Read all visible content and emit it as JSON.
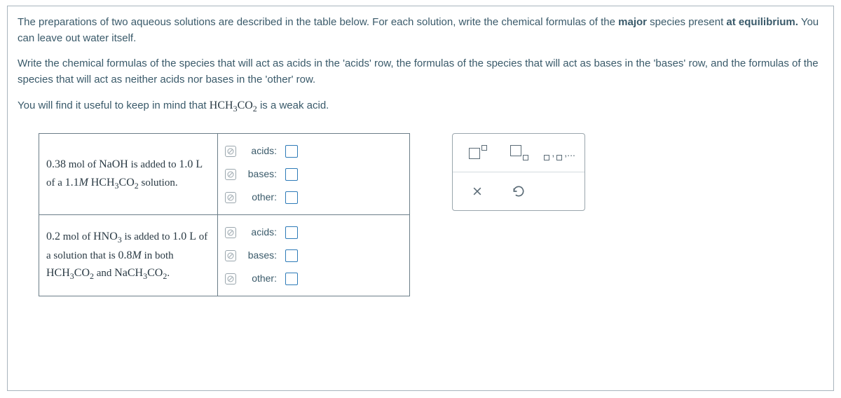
{
  "prompt": {
    "p1a": "The preparations of two aqueous solutions are described in the table below. For each solution, write the chemical formulas of the ",
    "p1b": "major",
    "p1c": " species present ",
    "p1d": "at equilibrium.",
    "p1e": " You can leave out water itself.",
    "p2": "Write the chemical formulas of the species that will act as acids in the 'acids' row, the formulas of the species that will act as bases in the 'bases' row, and the formulas of the species that will act as neither acids nor bases in the 'other' row.",
    "p3a": "You will find it useful to keep in mind that ",
    "p3b": " is a weak acid."
  },
  "formula_weak_acid": "HCH₃CO₂",
  "table": {
    "row1": {
      "desc_a": "0.38 mol of NaOH is added to 1.0 L of a 1.1",
      "desc_b": "M",
      "desc_c": " HCH₃CO₂ solution."
    },
    "row2": {
      "desc_a": "0.2 mol of HNO₃ is added to 1.0 L of a solution that is 0.8",
      "desc_b": "M",
      "desc_c": " in both HCH₃CO₂ and NaCH₃CO₂."
    },
    "labels": {
      "acids": "acids:",
      "bases": "bases:",
      "other": "other:"
    }
  },
  "tools": {
    "superscript": "superscript-tool",
    "subscript": "subscript-tool",
    "list": "list-tool",
    "list_text": "▢,▢,...",
    "clear": "×",
    "undo": "undo"
  }
}
